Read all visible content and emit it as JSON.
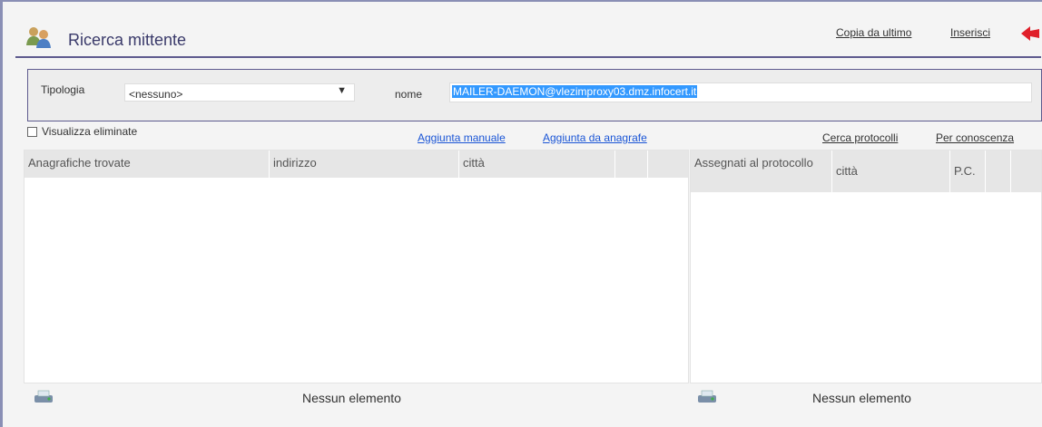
{
  "header": {
    "title": "Ricerca mittente",
    "copy_last_label": "Copia da ultimo",
    "insert_label": "Inserisci",
    "icon": "users-search-icon",
    "back_icon": "back-arrow-icon",
    "accent_color": "#5e5a8e",
    "back_color": "#e0202a"
  },
  "filter": {
    "tipologia_label": "Tipologia",
    "tipologia_value": "<nessuno>",
    "nome_label": "nome",
    "nome_value": "MAILER-DAEMON@vlezimproxy03.dmz.infocert.it"
  },
  "options": {
    "show_deleted_label": "Visualizza eliminate",
    "show_deleted_checked": false
  },
  "actions": {
    "add_manual": "Aggiunta manuale",
    "add_from_registry": "Aggiunta da anagrafe",
    "search_protocols": "Cerca protocolli",
    "for_knowledge": "Per conoscenza"
  },
  "left_grid": {
    "columns": [
      "Anagrafiche trovate",
      "indirizzo",
      "città",
      "",
      ""
    ],
    "rows": [],
    "empty_text": "Nessun elemento"
  },
  "right_grid": {
    "columns": [
      "Assegnati al protocollo",
      "città",
      "P.C.",
      "",
      ""
    ],
    "rows": [],
    "empty_text": "Nessun elemento"
  }
}
